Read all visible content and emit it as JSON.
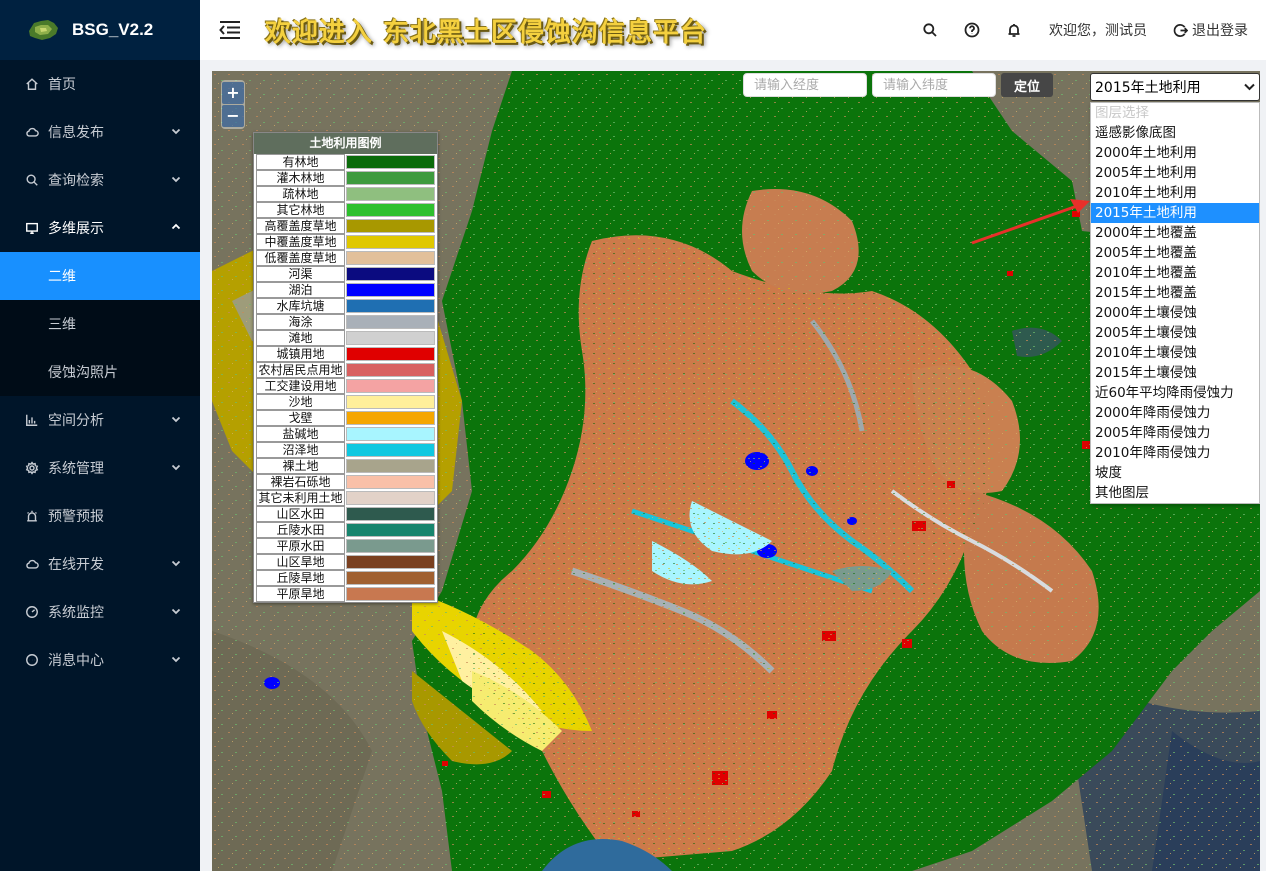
{
  "brand": {
    "name": "BSG_V2.2"
  },
  "header": {
    "title": "欢迎进入 东北黑土区侵蚀沟信息平台",
    "welcome": "欢迎您，测试员",
    "logout": "退出登录"
  },
  "sidebar": {
    "items": [
      {
        "label": "首页",
        "icon": "home-icon"
      },
      {
        "label": "信息发布",
        "icon": "cloud-icon"
      },
      {
        "label": "查询检索",
        "icon": "search-icon"
      },
      {
        "label": "多维展示",
        "icon": "monitor-icon"
      },
      {
        "label": "空间分析",
        "icon": "bar-chart-icon"
      },
      {
        "label": "系统管理",
        "icon": "gear-icon"
      },
      {
        "label": "预警预报",
        "icon": "alarm-icon"
      },
      {
        "label": "在线开发",
        "icon": "cloud-icon"
      },
      {
        "label": "系统监控",
        "icon": "dashboard-icon"
      },
      {
        "label": "消息中心",
        "icon": "chat-icon"
      }
    ],
    "submenu": [
      "二维",
      "三维",
      "侵蚀沟照片"
    ]
  },
  "map": {
    "zoom_in": "+",
    "zoom_out": "−",
    "lon_placeholder": "请输入经度",
    "lat_placeholder": "请输入纬度",
    "locate": "定位",
    "layer_selected": "2015年土地利用",
    "layer_options": [
      "图层选择",
      "遥感影像底图",
      "2000年土地利用",
      "2005年土地利用",
      "2010年土地利用",
      "2015年土地利用",
      "2000年土地覆盖",
      "2005年土地覆盖",
      "2010年土地覆盖",
      "2015年土地覆盖",
      "2000年土壤侵蚀",
      "2005年土壤侵蚀",
      "2010年土壤侵蚀",
      "2015年土壤侵蚀",
      "近60年平均降雨侵蚀力",
      "2000年降雨侵蚀力",
      "2005年降雨侵蚀力",
      "2010年降雨侵蚀力",
      "坡度",
      "其他图层"
    ]
  },
  "legend": {
    "title": "土地利用图例",
    "items": [
      {
        "label": "有林地",
        "color": "#0a6b0a"
      },
      {
        "label": "灌木林地",
        "color": "#3d9a3d"
      },
      {
        "label": "疏林地",
        "color": "#8fbf7f"
      },
      {
        "label": "其它林地",
        "color": "#2ec02e"
      },
      {
        "label": "高覆盖度草地",
        "color": "#a89800"
      },
      {
        "label": "中覆盖度草地",
        "color": "#e0c800"
      },
      {
        "label": "低覆盖度草地",
        "color": "#e2c09a"
      },
      {
        "label": "河渠",
        "color": "#0b0b80"
      },
      {
        "label": "湖泊",
        "color": "#0000ff"
      },
      {
        "label": "水库坑塘",
        "color": "#1f6fb2"
      },
      {
        "label": "海涂",
        "color": "#a9b0b8"
      },
      {
        "label": "滩地",
        "color": "#d0d0d0"
      },
      {
        "label": "城镇用地",
        "color": "#e00000"
      },
      {
        "label": "农村居民点用地",
        "color": "#d86060"
      },
      {
        "label": "工交建设用地",
        "color": "#f4a3a3"
      },
      {
        "label": "沙地",
        "color": "#ffef9a"
      },
      {
        "label": "戈壁",
        "color": "#f5a600"
      },
      {
        "label": "盐碱地",
        "color": "#a8f5ff"
      },
      {
        "label": "沼泽地",
        "color": "#10c8e0"
      },
      {
        "label": "裸土地",
        "color": "#a8a48c"
      },
      {
        "label": "裸岩石砾地",
        "color": "#f9c0a8"
      },
      {
        "label": "其它未利用土地",
        "color": "#e2d2c8"
      },
      {
        "label": "山区水田",
        "color": "#2e5a4e"
      },
      {
        "label": "丘陵水田",
        "color": "#18856e"
      },
      {
        "label": "平原水田",
        "color": "#7a9a8e"
      },
      {
        "label": "山区旱地",
        "color": "#7a4020"
      },
      {
        "label": "丘陵旱地",
        "color": "#a06030"
      },
      {
        "label": "平原旱地",
        "color": "#c87850"
      }
    ]
  }
}
